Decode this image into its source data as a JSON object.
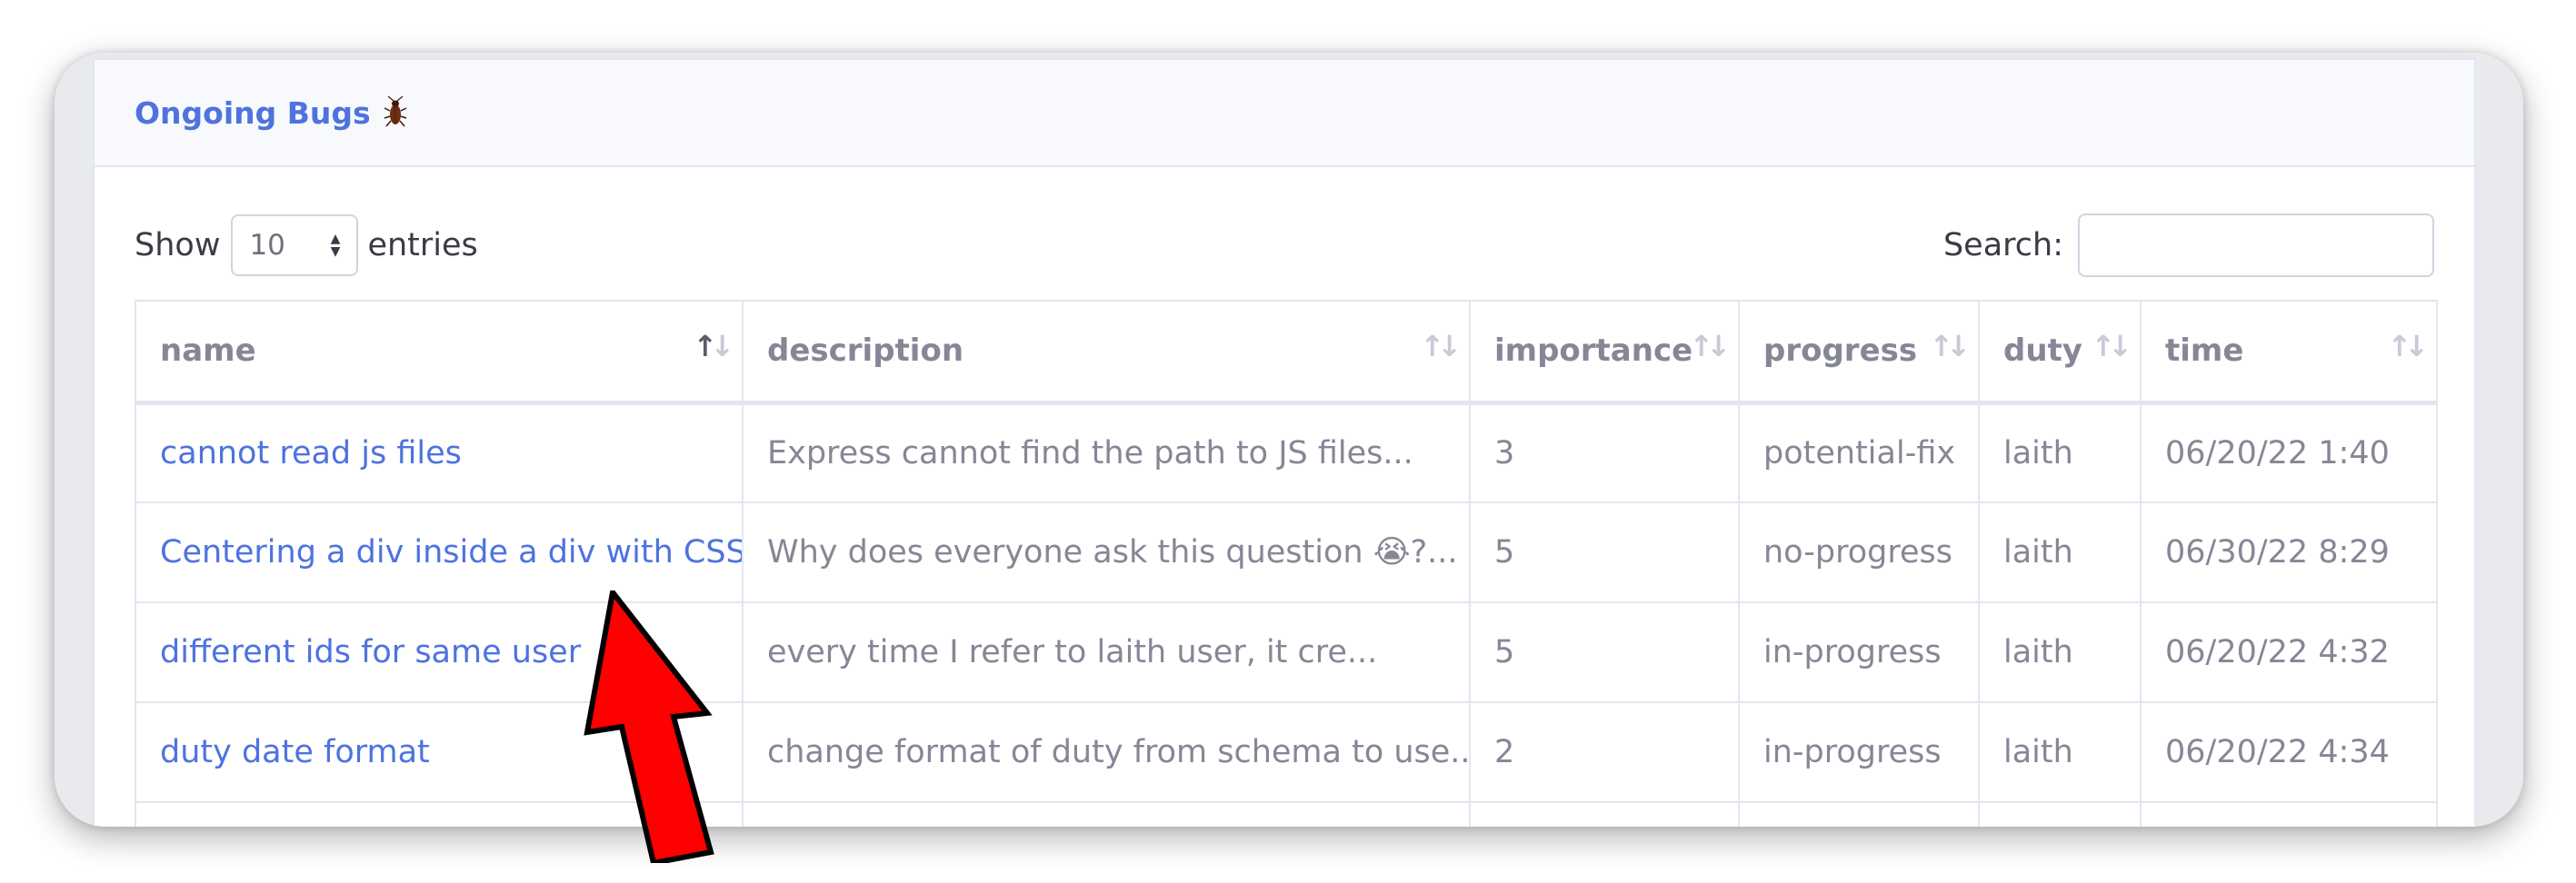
{
  "card": {
    "title": "Ongoing Bugs",
    "title_icon": "cockroach-icon",
    "accent_color": "#4e73df"
  },
  "controls": {
    "show_label": "Show",
    "entries_value": "10",
    "entries_label": "entries",
    "search_label": "Search:",
    "search_value": ""
  },
  "table": {
    "columns": [
      {
        "label": "name",
        "sorted": "ascending"
      },
      {
        "label": "description",
        "sorted": "none"
      },
      {
        "label": "importance",
        "sorted": "none"
      },
      {
        "label": "progress",
        "sorted": "none"
      },
      {
        "label": "duty",
        "sorted": "none"
      },
      {
        "label": "time",
        "sorted": "none"
      }
    ],
    "rows": [
      {
        "name": "cannot read js files",
        "description": "Express cannot find the path to JS files...",
        "importance": "3",
        "progress": "potential-fix",
        "duty": "laith",
        "time": "06/20/22 1:40"
      },
      {
        "name": "Centering a div inside a div with CSS",
        "description": "Why does everyone ask this question 😭?...",
        "importance": "5",
        "progress": "no-progress",
        "duty": "laith",
        "time": "06/30/22 8:29"
      },
      {
        "name": "different ids for same user",
        "description": "every time I refer to laith user, it cre...",
        "importance": "5",
        "progress": "in-progress",
        "duty": "laith",
        "time": "06/20/22 4:32"
      },
      {
        "name": "duty date format",
        "description": "change format of duty from schema to use...",
        "importance": "2",
        "progress": "in-progress",
        "duty": "laith",
        "time": "06/20/22 4:34"
      }
    ]
  },
  "annotation": {
    "icon": "red-arrow-icon",
    "color": "#ff0000"
  }
}
